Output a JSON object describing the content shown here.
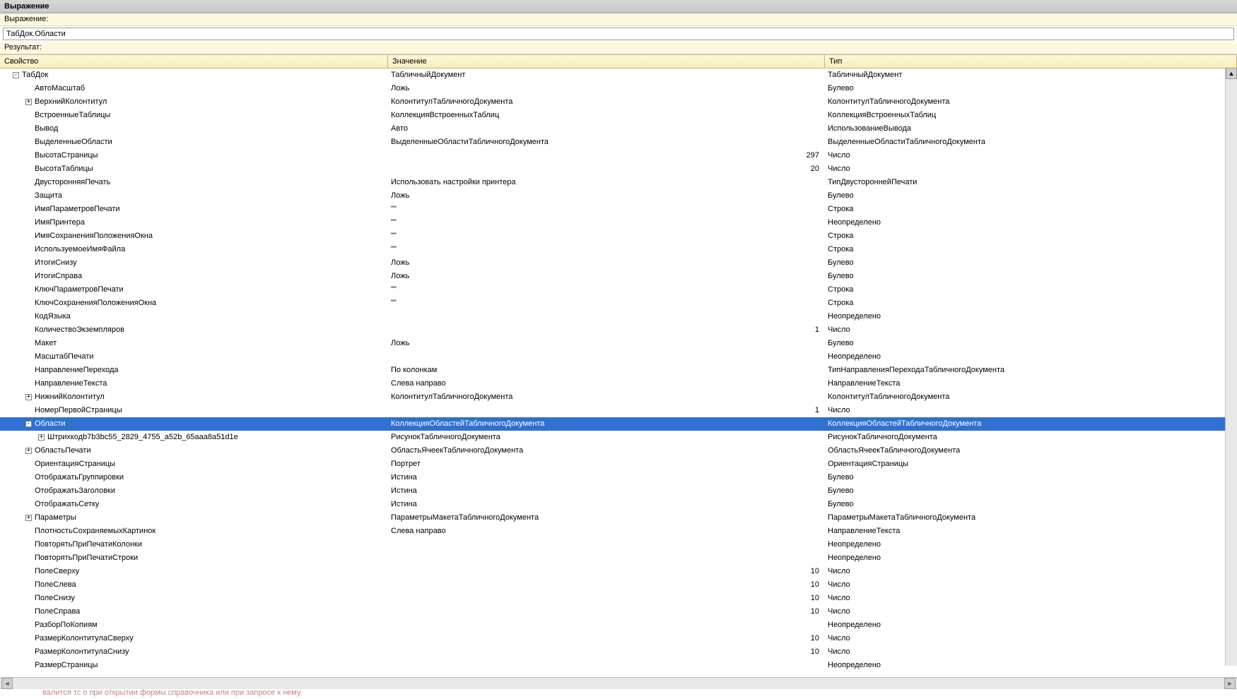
{
  "window": {
    "title": "Выражение"
  },
  "labels": {
    "expression": "Выражение:",
    "result": "Результат:"
  },
  "input": {
    "expression_value": "ТабДок.Области"
  },
  "columns": {
    "property": "Свойство",
    "value": "Значение",
    "type": "Тип"
  },
  "bottom_strip": "валится тс о при открытии формы справочника или при запросе к нему",
  "rows": [
    {
      "depth": 0,
      "toggle": "-",
      "prop": "ТабДок",
      "val": "ТабличныйДокумент",
      "type": "ТабличныйДокумент",
      "num": false
    },
    {
      "depth": 1,
      "toggle": "",
      "prop": "АвтоМасштаб",
      "val": "Ложь",
      "type": "Булево",
      "num": false
    },
    {
      "depth": 1,
      "toggle": "+",
      "prop": "ВерхнийКолонтитул",
      "val": "КолонтитулТабличногоДокумента",
      "type": "КолонтитулТабличногоДокумента",
      "num": false
    },
    {
      "depth": 1,
      "toggle": "",
      "prop": "ВстроенныеТаблицы",
      "val": "КоллекцияВстроенныхТаблиц",
      "type": "КоллекцияВстроенныхТаблиц",
      "num": false
    },
    {
      "depth": 1,
      "toggle": "",
      "prop": "Вывод",
      "val": "Авто",
      "type": "ИспользованиеВывода",
      "num": false
    },
    {
      "depth": 1,
      "toggle": "",
      "prop": "ВыделенныеОбласти",
      "val": "ВыделенныеОбластиТабличногоДокумента",
      "type": "ВыделенныеОбластиТабличногоДокумента",
      "num": false
    },
    {
      "depth": 1,
      "toggle": "",
      "prop": "ВысотаСтраницы",
      "val": "297",
      "type": "Число",
      "num": true
    },
    {
      "depth": 1,
      "toggle": "",
      "prop": "ВысотаТаблицы",
      "val": "20",
      "type": "Число",
      "num": true
    },
    {
      "depth": 1,
      "toggle": "",
      "prop": "ДвусторонняяПечать",
      "val": "Использовать настройки принтера",
      "type": "ТипДвустороннейПечати",
      "num": false
    },
    {
      "depth": 1,
      "toggle": "",
      "prop": "Защита",
      "val": "Ложь",
      "type": "Булево",
      "num": false
    },
    {
      "depth": 1,
      "toggle": "",
      "prop": "ИмяПараметровПечати",
      "val": "\"\"",
      "type": "Строка",
      "num": false
    },
    {
      "depth": 1,
      "toggle": "",
      "prop": "ИмяПринтера",
      "val": "\"\"",
      "type": "Неопределено",
      "num": false
    },
    {
      "depth": 1,
      "toggle": "",
      "prop": "ИмяСохраненияПоложенияОкна",
      "val": "\"\"",
      "type": "Строка",
      "num": false
    },
    {
      "depth": 1,
      "toggle": "",
      "prop": "ИспользуемоеИмяФайла",
      "val": "\"\"",
      "type": "Строка",
      "num": false
    },
    {
      "depth": 1,
      "toggle": "",
      "prop": "ИтогиСнизу",
      "val": "Ложь",
      "type": "Булево",
      "num": false
    },
    {
      "depth": 1,
      "toggle": "",
      "prop": "ИтогиСправа",
      "val": "Ложь",
      "type": "Булево",
      "num": false
    },
    {
      "depth": 1,
      "toggle": "",
      "prop": "КлючПараметровПечати",
      "val": "\"\"",
      "type": "Строка",
      "num": false
    },
    {
      "depth": 1,
      "toggle": "",
      "prop": "КлючСохраненияПоложенияОкна",
      "val": "\"\"",
      "type": "Строка",
      "num": false
    },
    {
      "depth": 1,
      "toggle": "",
      "prop": "КодЯзыка",
      "val": "",
      "type": "Неопределено",
      "num": false
    },
    {
      "depth": 1,
      "toggle": "",
      "prop": "КоличествоЭкземпляров",
      "val": "1",
      "type": "Число",
      "num": true
    },
    {
      "depth": 1,
      "toggle": "",
      "prop": "Макет",
      "val": "Ложь",
      "type": "Булево",
      "num": false
    },
    {
      "depth": 1,
      "toggle": "",
      "prop": "МасштабПечати",
      "val": "",
      "type": "Неопределено",
      "num": false
    },
    {
      "depth": 1,
      "toggle": "",
      "prop": "НаправлениеПерехода",
      "val": "По колонкам",
      "type": "ТипНаправленияПереходаТабличногоДокумента",
      "num": false
    },
    {
      "depth": 1,
      "toggle": "",
      "prop": "НаправлениеТекста",
      "val": "Слева направо",
      "type": "НаправлениеТекста",
      "num": false
    },
    {
      "depth": 1,
      "toggle": "+",
      "prop": "НижнийКолонтитул",
      "val": "КолонтитулТабличногоДокумента",
      "type": "КолонтитулТабличногоДокумента",
      "num": false
    },
    {
      "depth": 1,
      "toggle": "",
      "prop": "НомерПервойСтраницы",
      "val": "1",
      "type": "Число",
      "num": true
    },
    {
      "depth": 1,
      "toggle": "-",
      "prop": "Области",
      "val": "КоллекцияОбластейТабличногоДокумента",
      "type": "КоллекцияОбластейТабличногоДокумента",
      "num": false,
      "selected": true
    },
    {
      "depth": 2,
      "toggle": "+",
      "prop": "Штрихкодb7b3bc55_2829_4755_a52b_65aaa8a51d1e",
      "val": "РисунокТабличногоДокумента",
      "type": "РисунокТабличногоДокумента",
      "num": false
    },
    {
      "depth": 1,
      "toggle": "+",
      "prop": "ОбластьПечати",
      "val": "ОбластьЯчеекТабличногоДокумента",
      "type": "ОбластьЯчеекТабличногоДокумента",
      "num": false
    },
    {
      "depth": 1,
      "toggle": "",
      "prop": "ОриентацияСтраницы",
      "val": "Портрет",
      "type": "ОриентацияСтраницы",
      "num": false
    },
    {
      "depth": 1,
      "toggle": "",
      "prop": "ОтображатьГруппировки",
      "val": "Истина",
      "type": "Булево",
      "num": false
    },
    {
      "depth": 1,
      "toggle": "",
      "prop": "ОтображатьЗаголовки",
      "val": "Истина",
      "type": "Булево",
      "num": false
    },
    {
      "depth": 1,
      "toggle": "",
      "prop": "ОтображатьСетку",
      "val": "Истина",
      "type": "Булево",
      "num": false
    },
    {
      "depth": 1,
      "toggle": "+",
      "prop": "Параметры",
      "val": "ПараметрыМакетаТабличногоДокумента",
      "type": "ПараметрыМакетаТабличногоДокумента",
      "num": false
    },
    {
      "depth": 1,
      "toggle": "",
      "prop": "ПлотностьСохраняемыхКартинок",
      "val": "Слева направо",
      "type": "НаправлениеТекста",
      "num": false
    },
    {
      "depth": 1,
      "toggle": "",
      "prop": "ПовторятьПриПечатиКолонки",
      "val": "",
      "type": "Неопределено",
      "num": false
    },
    {
      "depth": 1,
      "toggle": "",
      "prop": "ПовторятьПриПечатиСтроки",
      "val": "",
      "type": "Неопределено",
      "num": false
    },
    {
      "depth": 1,
      "toggle": "",
      "prop": "ПолеСверху",
      "val": "10",
      "type": "Число",
      "num": true
    },
    {
      "depth": 1,
      "toggle": "",
      "prop": "ПолеСлева",
      "val": "10",
      "type": "Число",
      "num": true
    },
    {
      "depth": 1,
      "toggle": "",
      "prop": "ПолеСнизу",
      "val": "10",
      "type": "Число",
      "num": true
    },
    {
      "depth": 1,
      "toggle": "",
      "prop": "ПолеСправа",
      "val": "10",
      "type": "Число",
      "num": true
    },
    {
      "depth": 1,
      "toggle": "",
      "prop": "РазборПоКопиям",
      "val": "",
      "type": "Неопределено",
      "num": false
    },
    {
      "depth": 1,
      "toggle": "",
      "prop": "РазмерКолонтитулаСверху",
      "val": "10",
      "type": "Число",
      "num": true
    },
    {
      "depth": 1,
      "toggle": "",
      "prop": "РазмерКолонтитулаСнизу",
      "val": "10",
      "type": "Число",
      "num": true
    },
    {
      "depth": 1,
      "toggle": "",
      "prop": "РазмерСтраницы",
      "val": "",
      "type": "Неопределено",
      "num": false
    }
  ]
}
